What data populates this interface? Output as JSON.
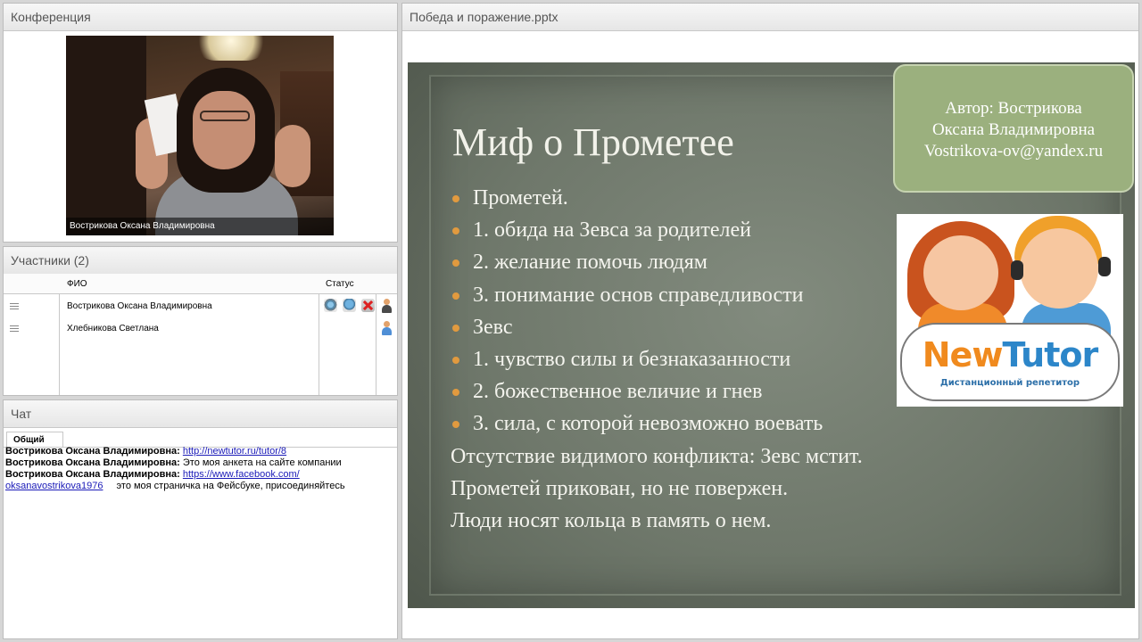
{
  "panels": {
    "conference": "Конференция",
    "participants": "Участники (2)",
    "chat": "Чат",
    "presentation": "Победа и поражение.pptx"
  },
  "video": {
    "caption": "Вострикова Оксана Владимировна"
  },
  "participants": {
    "columns": [
      "ФИО",
      "Статус"
    ],
    "rows": [
      {
        "name": "Вострикова Оксана Владимировна",
        "status_icons": [
          "webcam-icon",
          "microphone-icon",
          "muted-icon",
          "presenter-user-icon"
        ],
        "role_color": "#4a4a4a"
      },
      {
        "name": "Хлебникова Светлана",
        "status_icons": [
          "listener-user-icon"
        ],
        "role_color": "#4f8fd6"
      }
    ]
  },
  "chat": {
    "tab": "Общий",
    "messages": [
      {
        "author": "Вострикова Оксана Владимировна:",
        "link": "http://newtutor.ru/tutor/8",
        "text": ""
      },
      {
        "author": "Вострикова Оксана Владимировна:",
        "link": "",
        "text": "Это моя анкета на сайте компании"
      },
      {
        "author": "Вострикова Оксана Владимировна:",
        "link": "https://www.facebook.com/",
        "text": ""
      },
      {
        "author": "",
        "link": "oksanavostrikova1976",
        "text": "это моя страничка на Фейсбуке, присоединяйтесь"
      }
    ]
  },
  "slide": {
    "title": "Миф о Прометее",
    "author_box": [
      "Автор: Вострикова",
      "Оксана Владимировна",
      "Vostrikova-ov@yandex.ru"
    ],
    "lines": [
      {
        "text": "Прометей.",
        "bullet": true
      },
      {
        "text": "1. обида на Зевса за родителей",
        "bullet": true
      },
      {
        "text": "2. желание помочь людям",
        "bullet": true
      },
      {
        "text": "3. понимание основ справедливости",
        "bullet": true
      },
      {
        "text": "Зевс",
        "bullet": true
      },
      {
        "text": "1. чувство силы и безнаказанности",
        "bullet": true
      },
      {
        "text": "2. божественное величие и гнев",
        "bullet": true
      },
      {
        "text": "3. сила, с которой невозможно воевать",
        "bullet": true
      },
      {
        "text": "Отсутствие видимого конфликта: Зевс мстит.",
        "bullet": false
      },
      {
        "text": "Прометей прикован, но не повержен.",
        "bullet": false
      },
      {
        "text": "Люди носят кольца в память о нем.",
        "bullet": false
      }
    ],
    "logo": {
      "part1": "New",
      "part2": "Tutor",
      "subtitle": "Дистанционный репетитор"
    },
    "bullet_color": "#e19a3f"
  }
}
